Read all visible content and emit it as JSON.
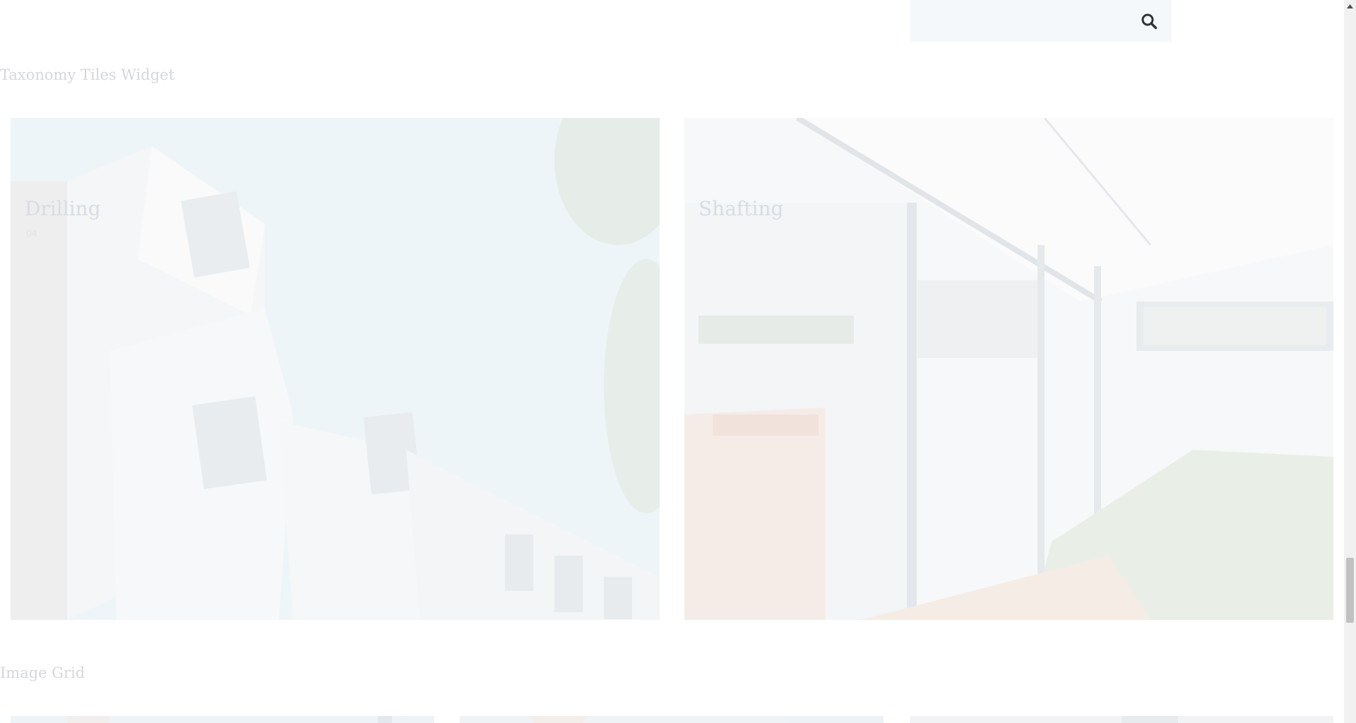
{
  "search": {
    "placeholder": "",
    "icon": "search-icon"
  },
  "sections": {
    "taxonomy_heading": "Taxonomy Tiles Widget",
    "image_grid_heading": "Image Grid"
  },
  "tiles": [
    {
      "label": "Drilling",
      "count": "04"
    },
    {
      "label": "Shafting",
      "count": ""
    }
  ],
  "colors": {
    "background": "#ffffff",
    "search_bg": "#f5f8fb",
    "heading": "#d4d7db",
    "tile_label": "#d6dde4"
  }
}
